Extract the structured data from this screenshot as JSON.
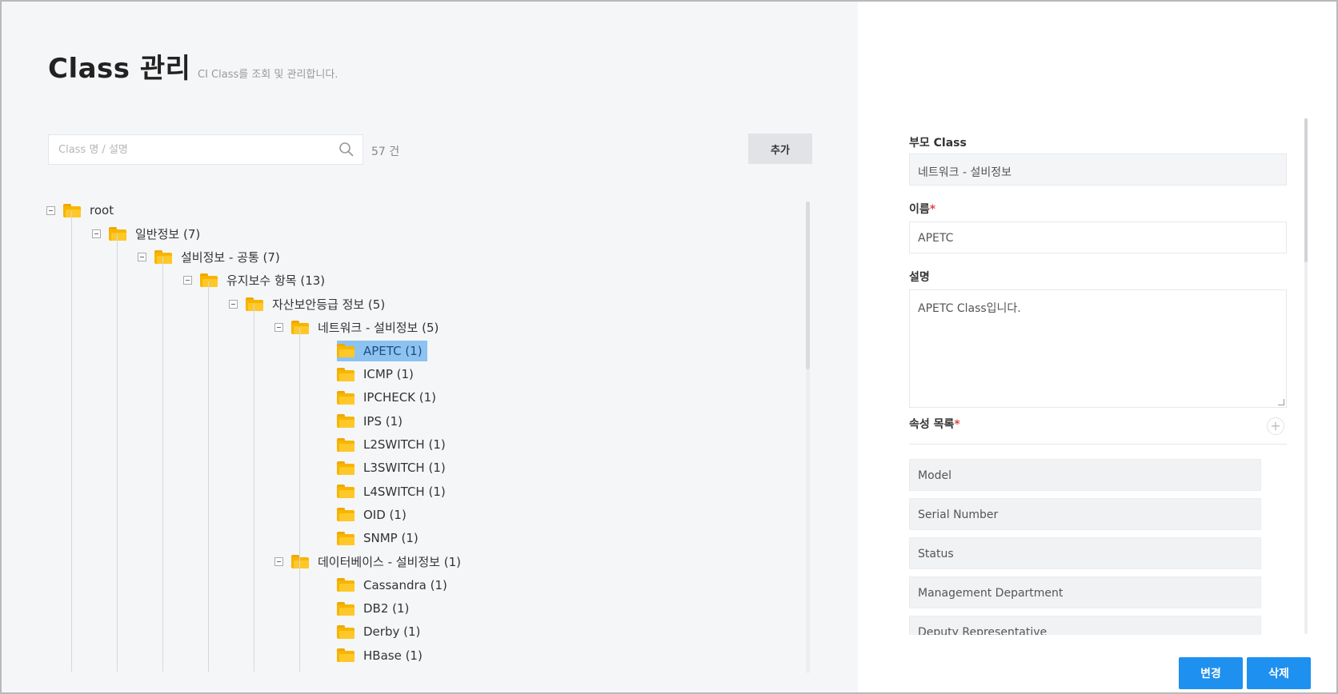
{
  "page": {
    "title": "Class 관리",
    "subtitle": "CI Class를 조회 및 관리합니다."
  },
  "search": {
    "placeholder": "Class 명 / 설명",
    "count": "57 건",
    "add_label": "추가"
  },
  "tree": {
    "nodes": [
      {
        "label": "root",
        "level": 0,
        "toggle": true,
        "selected": false
      },
      {
        "label": "일반정보 (7)",
        "level": 1,
        "toggle": true,
        "selected": false
      },
      {
        "label": "설비정보 - 공통 (7)",
        "level": 2,
        "toggle": true,
        "selected": false
      },
      {
        "label": "유지보수 항목 (13)",
        "level": 3,
        "toggle": true,
        "selected": false
      },
      {
        "label": "자산보안등급 정보 (5)",
        "level": 4,
        "toggle": true,
        "selected": false
      },
      {
        "label": "네트워크 - 설비정보 (5)",
        "level": 5,
        "toggle": true,
        "selected": false
      },
      {
        "label": "APETC (1)",
        "level": 6,
        "toggle": false,
        "selected": true
      },
      {
        "label": "ICMP (1)",
        "level": 6,
        "toggle": false,
        "selected": false
      },
      {
        "label": "IPCHECK (1)",
        "level": 6,
        "toggle": false,
        "selected": false
      },
      {
        "label": "IPS (1)",
        "level": 6,
        "toggle": false,
        "selected": false
      },
      {
        "label": "L2SWITCH (1)",
        "level": 6,
        "toggle": false,
        "selected": false
      },
      {
        "label": "L3SWITCH (1)",
        "level": 6,
        "toggle": false,
        "selected": false
      },
      {
        "label": "L4SWITCH (1)",
        "level": 6,
        "toggle": false,
        "selected": false
      },
      {
        "label": "OID (1)",
        "level": 6,
        "toggle": false,
        "selected": false
      },
      {
        "label": "SNMP (1)",
        "level": 6,
        "toggle": false,
        "selected": false
      },
      {
        "label": "데이터베이스 - 설비정보 (1)",
        "level": 5,
        "toggle": true,
        "selected": false
      },
      {
        "label": "Cassandra (1)",
        "level": 6,
        "toggle": false,
        "selected": false
      },
      {
        "label": "DB2 (1)",
        "level": 6,
        "toggle": false,
        "selected": false
      },
      {
        "label": "Derby (1)",
        "level": 6,
        "toggle": false,
        "selected": false
      },
      {
        "label": "HBase (1)",
        "level": 6,
        "toggle": false,
        "selected": false
      }
    ]
  },
  "detail": {
    "parent_label": "부모 Class",
    "parent_value": "네트워크 - 설비정보",
    "name_label": "이름",
    "name_value": "APETC",
    "desc_label": "설명",
    "desc_value": "APETC Class입니다.",
    "attrs_label": "속성 목록",
    "attrs_add": "+",
    "required_mark": "*",
    "attrs": [
      "Model",
      "Serial Number",
      "Status",
      "Management Department",
      "Deputy Representative"
    ]
  },
  "actions": {
    "edit_label": "변경",
    "delete_label": "삭제"
  },
  "colors": {
    "primary": "#1e90ef",
    "selected": "#8dc3f0",
    "folder": "#f7b500",
    "required": "#e04848"
  }
}
